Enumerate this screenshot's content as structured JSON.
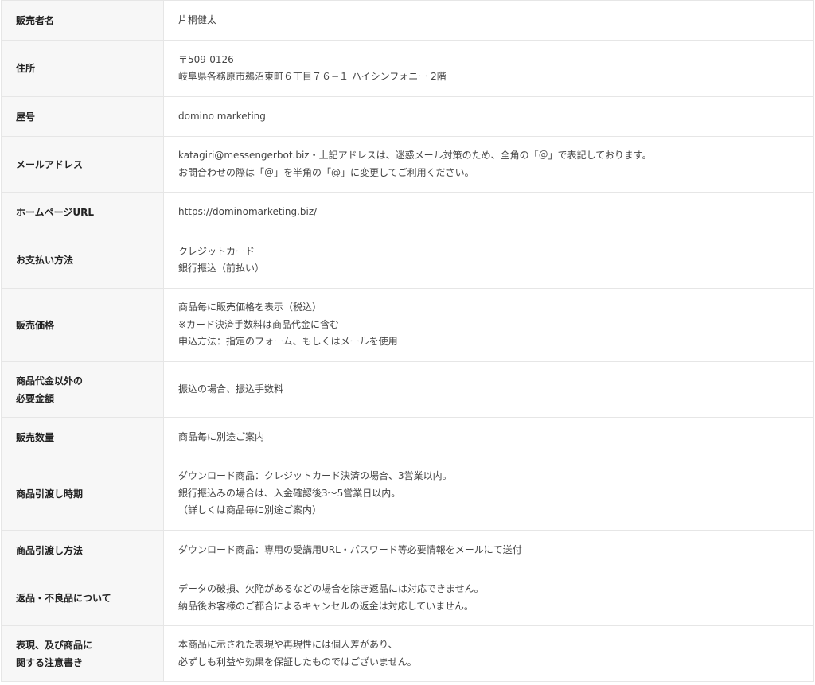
{
  "rows": [
    {
      "label": [
        "販売者名"
      ],
      "value": [
        "片桐健太"
      ]
    },
    {
      "label": [
        "住所"
      ],
      "value": [
        "〒509-0126",
        "岐阜県各務原市鵜沼東町６丁目７６−１ ハイシンフォニー 2階"
      ]
    },
    {
      "label": [
        "屋号"
      ],
      "value": [
        "domino marketing"
      ]
    },
    {
      "label": [
        "メールアドレス"
      ],
      "value": [
        "katagiri@messengerbot.biz・上記アドレスは、迷惑メール対策のため、全角の「＠」で表記しております。",
        "お問合わせの際は「＠」を半角の「@」に変更してご利用ください。"
      ]
    },
    {
      "label": [
        "ホームページURL"
      ],
      "value": [
        "https://dominomarketing.biz/"
      ]
    },
    {
      "label": [
        "お支払い方法"
      ],
      "value": [
        "クレジットカード",
        "銀行振込（前払い）"
      ]
    },
    {
      "label": [
        "販売価格"
      ],
      "value": [
        "商品毎に販売価格を表示（税込）",
        "※カード決済手数料は商品代金に含む",
        "申込方法：指定のフォーム、もしくはメールを使用"
      ]
    },
    {
      "label": [
        "商品代金以外の",
        "必要金額"
      ],
      "value": [
        "振込の場合、振込手数料"
      ]
    },
    {
      "label": [
        "販売数量"
      ],
      "value": [
        "商品毎に別途ご案内"
      ]
    },
    {
      "label": [
        "商品引渡し時期"
      ],
      "value": [
        "ダウンロード商品：クレジットカード決済の場合、3営業以内。",
        "銀行振込みの場合は、入金確認後3〜5営業日以内。",
        "（詳しくは商品毎に別途ご案内）"
      ]
    },
    {
      "label": [
        "商品引渡し方法"
      ],
      "value": [
        "ダウンロード商品：専用の受講用URL・パスワード等必要情報をメールにて送付"
      ]
    },
    {
      "label": [
        "返品・不良品について"
      ],
      "value": [
        "データの破損、欠陥があるなどの場合を除き返品には対応できません。",
        "納品後お客様のご都合によるキャンセルの返金は対応していません。"
      ]
    },
    {
      "label": [
        "表現、及び商品に",
        "関する注意書き"
      ],
      "value": [
        "本商品に示された表現や再現性には個人差があり、",
        "必ずしも利益や効果を保証したものではございません。"
      ]
    }
  ]
}
